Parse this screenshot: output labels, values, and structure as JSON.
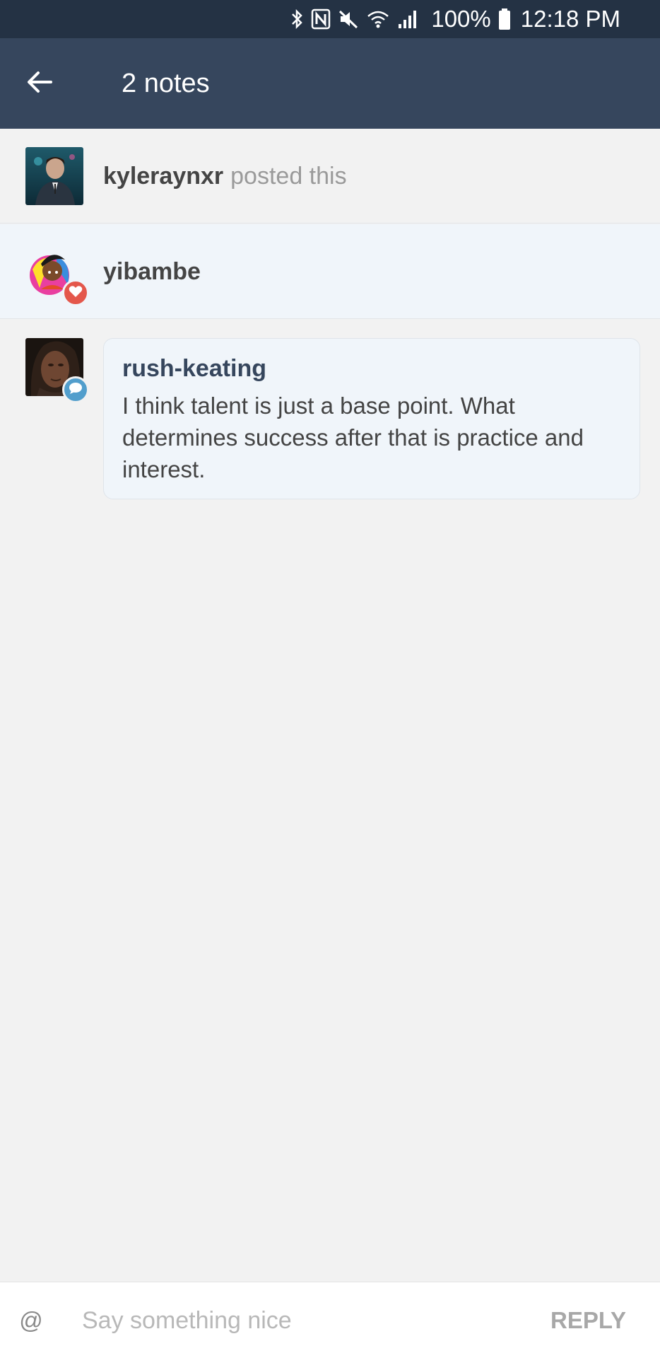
{
  "status_bar": {
    "icons": [
      "bluetooth-icon",
      "nfc-icon",
      "mute-icon",
      "wifi-icon",
      "signal-icon",
      "battery-icon"
    ],
    "battery": "100%",
    "time": "12:18 PM"
  },
  "header": {
    "title": "2 notes",
    "back_icon": "arrow-left-icon"
  },
  "notes": {
    "op": {
      "username": "kyleraynxr",
      "action": "posted this"
    },
    "like": {
      "username": "yibambe",
      "badge_icon": "heart-icon",
      "badge_color": "#e4574b"
    },
    "reply": {
      "username": "rush-keating",
      "text": "I think talent is just a base point. What determines success after that is practice and interest.",
      "badge_icon": "speech-bubble-icon",
      "badge_color": "#529ecc"
    }
  },
  "input_bar": {
    "mention_label": "@",
    "placeholder": "Say something nice",
    "value": "",
    "reply_label": "REPLY"
  },
  "colors": {
    "status_bar_bg": "#243244",
    "header_bg": "#36465d",
    "page_bg": "#f2f2f2",
    "highlight_bg": "#f0f5fa"
  }
}
